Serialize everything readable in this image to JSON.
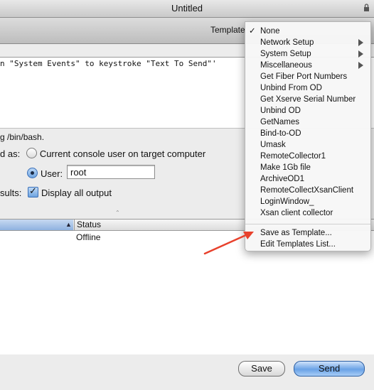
{
  "window": {
    "title": "Untitled"
  },
  "toolbar": {
    "template_label": "Template"
  },
  "script_editor": {
    "code": "n \"System Events\" to keystroke \"Text To Send\"'"
  },
  "note": "g /bin/bash.",
  "run_as": {
    "label": "d as:",
    "option_console": "Current console user on target computer",
    "option_user": "User:",
    "user_value": "root"
  },
  "results": {
    "label": "sults:",
    "checkbox_label": "Display all output"
  },
  "table": {
    "columns": [
      "Status"
    ],
    "rows": [
      {
        "status": "Offline"
      }
    ]
  },
  "buttons": {
    "save": "Save",
    "send": "Send"
  },
  "template_menu": {
    "items": [
      {
        "label": "None",
        "checked": true,
        "submenu": false
      },
      {
        "label": "Network Setup",
        "checked": false,
        "submenu": true
      },
      {
        "label": "System Setup",
        "checked": false,
        "submenu": true
      },
      {
        "label": "Miscellaneous",
        "checked": false,
        "submenu": true
      },
      {
        "label": "Get Fiber Port Numbers",
        "checked": false,
        "submenu": false
      },
      {
        "label": "Unbind From OD",
        "checked": false,
        "submenu": false
      },
      {
        "label": "Get Xserve Serial Number",
        "checked": false,
        "submenu": false
      },
      {
        "label": "Unbind OD",
        "checked": false,
        "submenu": false
      },
      {
        "label": "GetNames",
        "checked": false,
        "submenu": false
      },
      {
        "label": "Bind-to-OD",
        "checked": false,
        "submenu": false
      },
      {
        "label": "Umask",
        "checked": false,
        "submenu": false
      },
      {
        "label": "RemoteCollector1",
        "checked": false,
        "submenu": false
      },
      {
        "label": "Make 1Gb file",
        "checked": false,
        "submenu": false
      },
      {
        "label": "ArchiveOD1",
        "checked": false,
        "submenu": false
      },
      {
        "label": "RemoteCollectXsanClient",
        "checked": false,
        "submenu": false
      },
      {
        "label": "LoginWindow_",
        "checked": false,
        "submenu": false
      },
      {
        "label": "Xsan client collector",
        "checked": false,
        "submenu": false
      }
    ],
    "actions": [
      {
        "label": "Save as Template..."
      },
      {
        "label": "Edit Templates List..."
      }
    ],
    "checkmark": "✓"
  },
  "colors": {
    "annotation_arrow": "#e8412c",
    "default_button": "#6aa2e6"
  }
}
